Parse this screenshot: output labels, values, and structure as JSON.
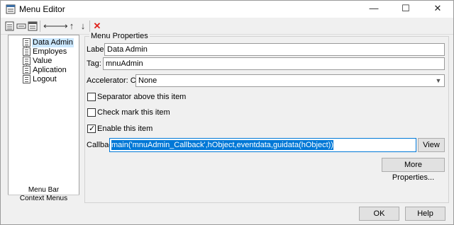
{
  "window": {
    "title": "Menu Editor",
    "minimize": "—",
    "maximize": "☐",
    "close": "✕"
  },
  "toolbar": {
    "new_menu_icon": "new-menu-icon",
    "new_item_icon": "new-menu-item-icon",
    "new_context_icon": "new-context-menu-icon",
    "move_left": "⟵",
    "move_right": "⟶",
    "move_up": "↑",
    "move_down": "↓",
    "delete": "✕"
  },
  "tree": {
    "items": [
      {
        "label": "Data Admin",
        "selected": true
      },
      {
        "label": "Employes",
        "selected": false
      },
      {
        "label": "Value",
        "selected": false
      },
      {
        "label": "Aplication",
        "selected": false
      },
      {
        "label": "Logout",
        "selected": false
      }
    ],
    "tab_menubar": "Menu Bar",
    "tab_context": "Context Menus"
  },
  "properties": {
    "legend": "Menu Properties",
    "label_caption": "Label:",
    "label_value": "Data Admin",
    "tag_caption": "Tag:",
    "tag_value": "mnuAdmin",
    "accelerator_caption": "Accelerator: Ctrl +",
    "accelerator_value": "None",
    "separator_label": "Separator above this item",
    "separator_checked": false,
    "checkmark_label": "Check mark this item",
    "checkmark_checked": false,
    "enable_label": "Enable this item",
    "enable_checked": true,
    "callback_caption": "Callback:",
    "callback_value": "main('mnuAdmin_Callback',hObject,eventdata,guidata(hObject))",
    "view_button": "View",
    "more_button": "More Properties..."
  },
  "footer": {
    "ok": "OK",
    "help": "Help"
  },
  "colors": {
    "selection": "#0078d7",
    "tree_selection": "#cce8ff",
    "delete_red": "#e0231c"
  }
}
